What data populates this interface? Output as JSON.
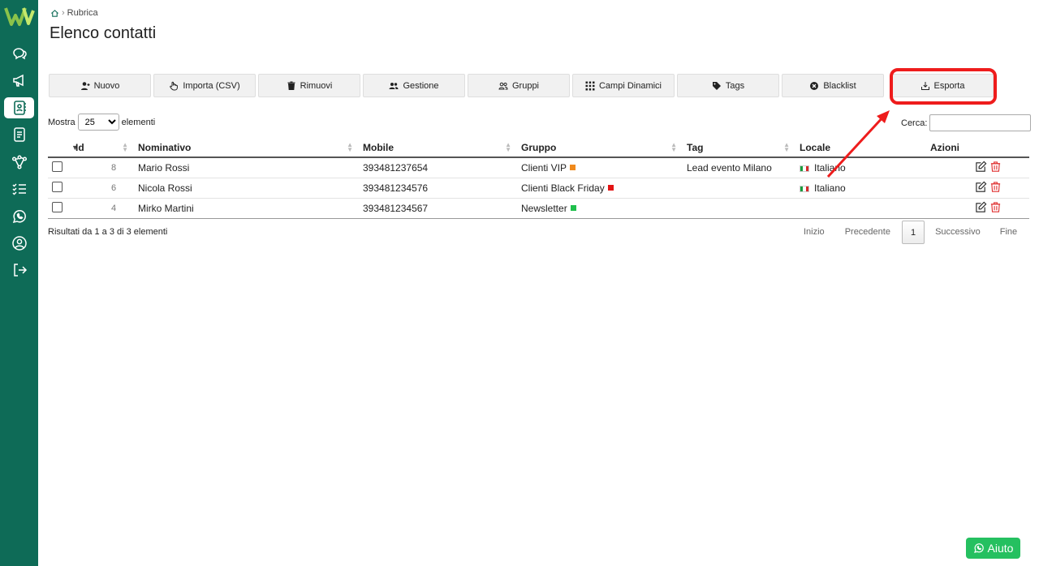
{
  "breadcrumb": {
    "label": "Rubrica"
  },
  "page": {
    "title": "Elenco contatti"
  },
  "toolbar": {
    "nuovo": "Nuovo",
    "importa": "Importa (CSV)",
    "rimuovi": "Rimuovi",
    "gestione": "Gestione",
    "gruppi": "Gruppi",
    "campi": "Campi Dinamici",
    "tags": "Tags",
    "blacklist": "Blacklist",
    "esporta": "Esporta"
  },
  "length": {
    "prefix": "Mostra",
    "value": "25",
    "suffix": "elementi"
  },
  "search": {
    "label": "Cerca:",
    "value": ""
  },
  "table": {
    "headers": {
      "id": "Id",
      "nominativo": "Nominativo",
      "mobile": "Mobile",
      "gruppo": "Gruppo",
      "tag": "Tag",
      "locale": "Locale",
      "azioni": "Azioni"
    },
    "rows": [
      {
        "id": "8",
        "nominativo": "Mario Rossi",
        "mobile": "393481237654",
        "gruppo": "Clienti VIP",
        "gruppo_color": "#f08a1c",
        "tag": "Lead evento Milano",
        "locale": "Italiano"
      },
      {
        "id": "6",
        "nominativo": "Nicola Rossi",
        "mobile": "393481234576",
        "gruppo": "Clienti Black Friday",
        "gruppo_color": "#e31414",
        "tag": "",
        "locale": "Italiano"
      },
      {
        "id": "4",
        "nominativo": "Mirko Martini",
        "mobile": "393481234567",
        "gruppo": "Newsletter",
        "gruppo_color": "#1fbf4c",
        "tag": "",
        "locale": ""
      }
    ]
  },
  "footer": {
    "info": "Risultati da 1 a 3 di 3 elementi",
    "pager": {
      "first": "Inizio",
      "prev": "Precedente",
      "current": "1",
      "next": "Successivo",
      "last": "Fine"
    }
  },
  "help": {
    "label": "Aiuto"
  },
  "colors": {
    "sidebar": "#0e6b57",
    "highlight": "#ee1c1c",
    "help": "#25c060"
  }
}
